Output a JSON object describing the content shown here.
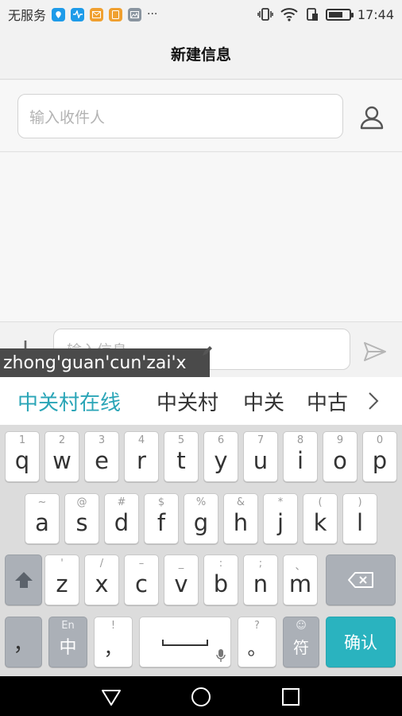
{
  "status_bar": {
    "carrier": "无服务",
    "time": "17:44",
    "battery_level": 0.7,
    "notification_icons": [
      "maps-icon",
      "health-icon",
      "mail-icon",
      "sim-icon",
      "gallery-icon"
    ],
    "more": "···"
  },
  "header": {
    "title": "新建信息"
  },
  "recipient": {
    "placeholder": "输入收件人"
  },
  "compose": {
    "placeholder": "输入信息"
  },
  "ime": {
    "pinyin": "zhong'guan'cun'zai'x",
    "candidates": [
      "中关村在线",
      "中关村",
      "中关",
      "中古"
    ],
    "accent_color": "#2aa5b7",
    "rows": [
      [
        {
          "k": "q",
          "s": "1"
        },
        {
          "k": "w",
          "s": "2"
        },
        {
          "k": "e",
          "s": "3"
        },
        {
          "k": "r",
          "s": "4"
        },
        {
          "k": "t",
          "s": "5"
        },
        {
          "k": "y",
          "s": "6"
        },
        {
          "k": "u",
          "s": "7"
        },
        {
          "k": "i",
          "s": "8"
        },
        {
          "k": "o",
          "s": "9"
        },
        {
          "k": "p",
          "s": "0"
        }
      ],
      [
        {
          "k": "a",
          "s": "~"
        },
        {
          "k": "s",
          "s": "@"
        },
        {
          "k": "d",
          "s": "#"
        },
        {
          "k": "f",
          "s": "$"
        },
        {
          "k": "g",
          "s": "%"
        },
        {
          "k": "h",
          "s": "&"
        },
        {
          "k": "j",
          "s": "*"
        },
        {
          "k": "k",
          "s": "("
        },
        {
          "k": "l",
          "s": ")"
        }
      ],
      [
        {
          "k": "z",
          "s": "'"
        },
        {
          "k": "x",
          "s": "/"
        },
        {
          "k": "c",
          "s": "–"
        },
        {
          "k": "v",
          "s": "_"
        },
        {
          "k": "b",
          "s": ":"
        },
        {
          "k": "n",
          "s": ";"
        },
        {
          "k": "m",
          "s": "、"
        }
      ]
    ],
    "bottom": {
      "comma": "，",
      "lang_sub": "En",
      "lang_main": "中",
      "punct_sub": "!",
      "punct_main": "，",
      "period_sub": "?",
      "period_main": "。",
      "symbol_sub": "☺",
      "symbol_main": "符",
      "confirm": "确认"
    }
  }
}
